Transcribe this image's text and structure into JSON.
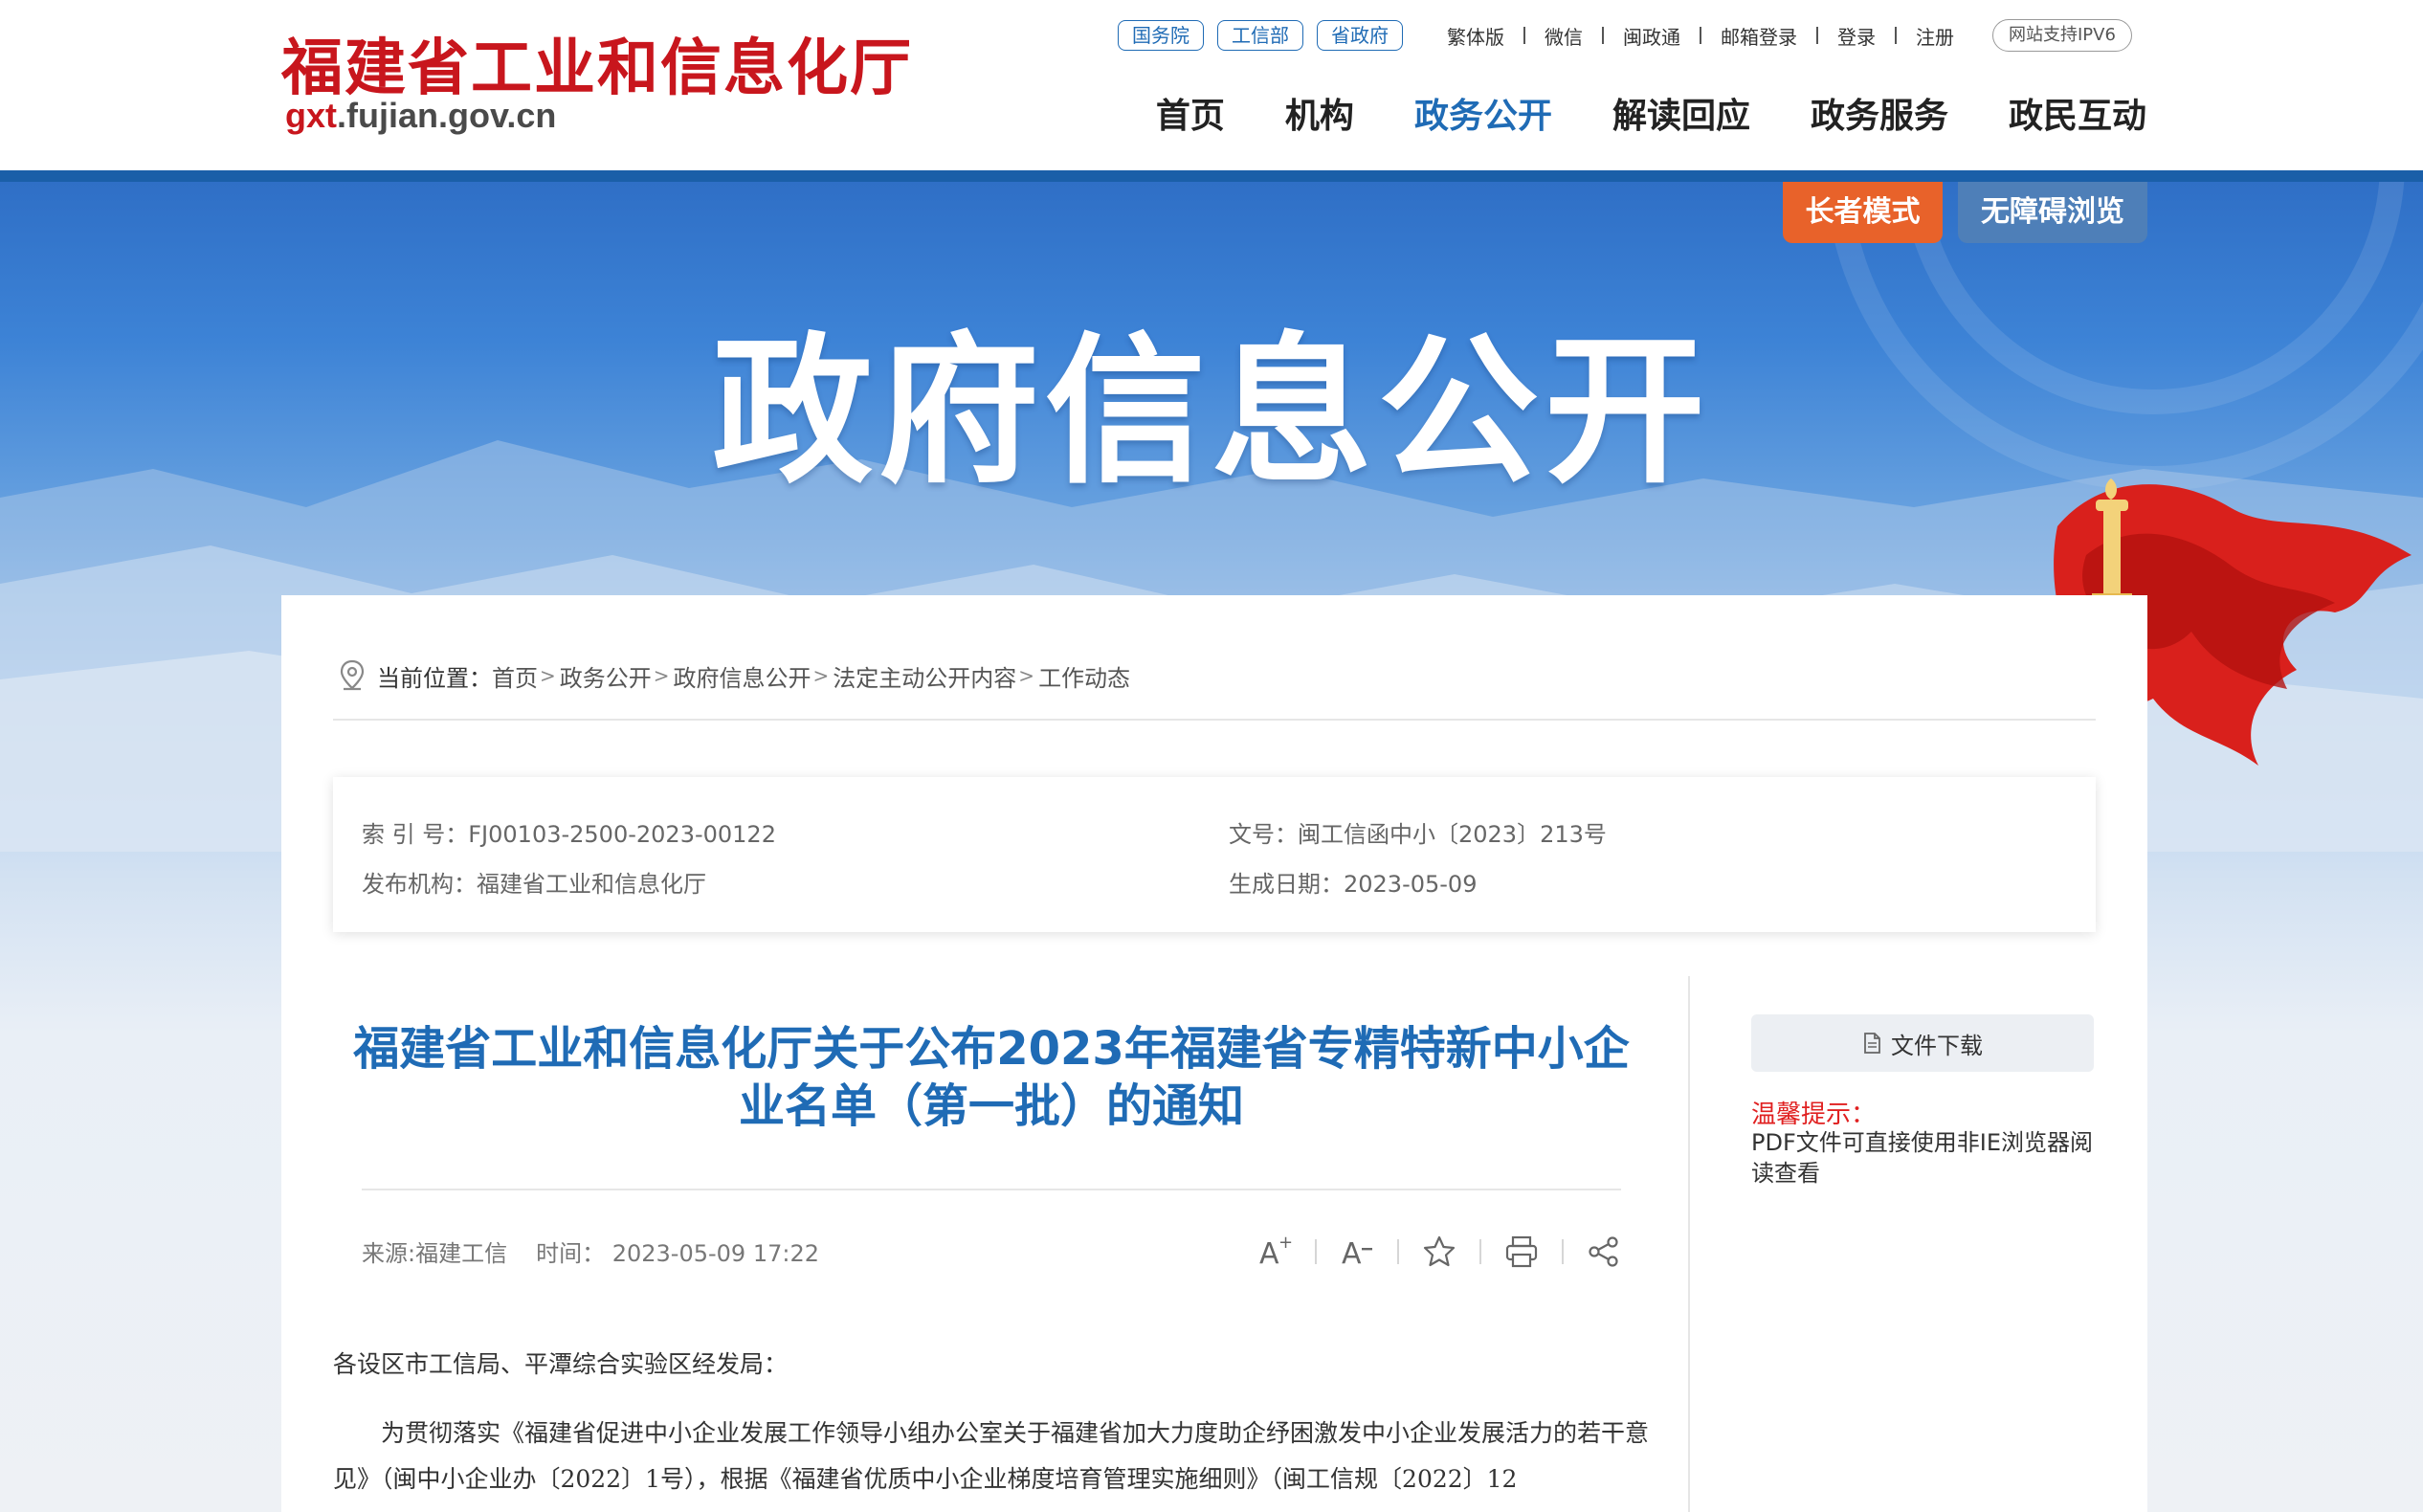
{
  "header": {
    "logo_cn": "福建省工业和信息化厅",
    "logo_en_prefix": "gxt",
    "logo_en_suffix": ".fujian.gov.cn",
    "pills": [
      "国务院",
      "工信部",
      "省政府"
    ],
    "util_links": [
      "繁体版",
      "微信",
      "闽政通",
      "邮箱登录",
      "登录",
      "注册"
    ],
    "ipv6": "网站支持IPV6",
    "nav": [
      {
        "label": "首页",
        "active": false
      },
      {
        "label": "机构",
        "active": false
      },
      {
        "label": "政务公开",
        "active": true
      },
      {
        "label": "解读回应",
        "active": false
      },
      {
        "label": "政务服务",
        "active": false
      },
      {
        "label": "政民互动",
        "active": false
      }
    ]
  },
  "banner": {
    "title": "政府信息公开",
    "elder_mode": "长者模式",
    "accessible": "无障碍浏览"
  },
  "breadcrumb": {
    "label": "当前位置：",
    "items": [
      "首页",
      "政务公开",
      "政府信息公开",
      "法定主动公开内容",
      "工作动态"
    ]
  },
  "meta": {
    "index_no": "索 引 号：FJ00103-2500-2023-00122",
    "doc_no": "文号：闽工信函中小〔2023〕213号",
    "publisher": "发布机构：福建省工业和信息化厅",
    "date": "生成日期：2023-05-09"
  },
  "article": {
    "title": "福建省工业和信息化厅关于公布2023年福建省专精特新中小企业名单（第一批）的通知",
    "source": "来源:福建工信",
    "time": "时间： 2023-05-09 17:22",
    "para0": "各设区市工信局、平潭综合实验区经发局：",
    "para1": "为贯彻落实《福建省促进中小企业发展工作领导小组办公室关于福建省加大力度助企纾困激发中小企业发展活力的若干意见》（闽中小企业办〔2022〕1号），根据《福建省优质中小企业梯度培育管理实施细则》（闽工信规〔2022〕12"
  },
  "sidebar": {
    "download": "文件下载",
    "tip_title": "温馨提示：",
    "tip_text": "PDF文件可直接使用非IE浏览器阅读查看"
  },
  "colors": {
    "brand_red": "#c8161d",
    "brand_blue": "#1f6bb5",
    "elder_orange": "#e8622a"
  }
}
